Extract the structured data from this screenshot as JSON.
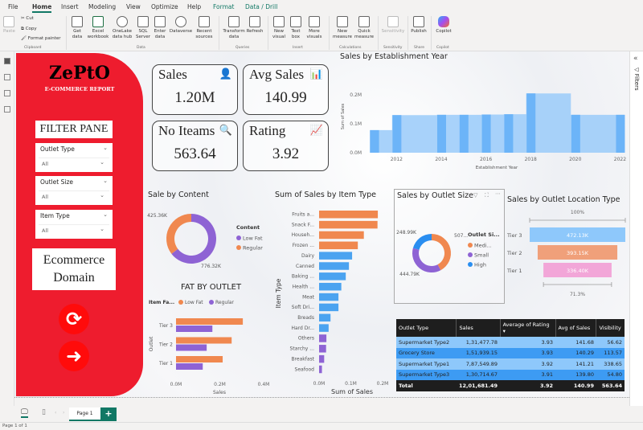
{
  "ribbon": {
    "tabs": [
      "File",
      "Home",
      "Insert",
      "Modeling",
      "View",
      "Optimize",
      "Help",
      "Format",
      "Data / Drill"
    ],
    "active_tab": "Home",
    "buttons": {
      "paste": "Paste",
      "cut": "Cut",
      "copy": "Copy",
      "format_painter": "Format painter",
      "get_data": "Get data",
      "excel": "Excel workbook",
      "onelake": "OneLake data hub",
      "sql": "SQL Server",
      "enter_data": "Enter data",
      "dataverse": "Dataverse",
      "recent": "Recent sources",
      "transform": "Transform data",
      "refresh": "Refresh",
      "new_visual": "New visual",
      "text_box": "Text box",
      "more_visuals": "More visuals",
      "new_measure": "New measure",
      "quick_measure": "Quick measure",
      "sensitivity": "Sensitivity",
      "publish": "Publish",
      "copilot": "Copilot"
    },
    "groups": [
      "Clipboard",
      "Data",
      "Queries",
      "Insert",
      "Calculations",
      "Sensitivity",
      "Share",
      "Copilot"
    ]
  },
  "left_panel": {
    "brand": "ZePtO",
    "subtitle": "E-COMMERCE REPORT",
    "filter_title": "FILTER PANE",
    "slicers": [
      {
        "label": "Outlet Type",
        "value": "All"
      },
      {
        "label": "Outlet Size",
        "value": "All"
      },
      {
        "label": "Item Type",
        "value": "All"
      }
    ],
    "domain_box": "Ecommerce Domain",
    "color": "#ee1c2e"
  },
  "cards": [
    {
      "title": "Sales",
      "value": "1.20M",
      "icon": "sales-person-icon"
    },
    {
      "title": "Avg Sales",
      "value": "140.99",
      "icon": "bar-chart-icon"
    },
    {
      "title": "No Iteams",
      "value": "563.64",
      "icon": "search-icon"
    },
    {
      "title": "Rating",
      "value": "3.92",
      "icon": "rating-chart-icon"
    }
  ],
  "filters_pane": {
    "label": "Filters"
  },
  "chart_data": [
    {
      "type": "area",
      "title": "Sales by Establishment Year",
      "xlabel": "Establishment Year",
      "ylabel": "Sum of Sales",
      "x": [
        2011,
        2012,
        2014,
        2015,
        2016,
        2017,
        2018,
        2020,
        2022
      ],
      "values": [
        0.078,
        0.13,
        0.131,
        0.131,
        0.132,
        0.133,
        0.205,
        0.131,
        0.131
      ],
      "x_ticks": [
        "2012",
        "2014",
        "2016",
        "2018",
        "2020",
        "2022"
      ],
      "y_ticks": [
        "0.0M",
        "0.1M",
        "0.2M"
      ],
      "ylim": [
        0,
        0.25
      ],
      "color": "#6cb4f8"
    },
    {
      "type": "pie",
      "title": "Sale by Content",
      "legend_title": "Content",
      "categories": [
        "Low Fat",
        "Regular"
      ],
      "values": [
        776.32,
        425.36
      ],
      "labels": [
        "776.32K",
        "425.36K"
      ],
      "colors": [
        "#8e63d4",
        "#f0884f"
      ]
    },
    {
      "type": "bar",
      "title": "FAT BY OUTLET",
      "legend_title": "Item Fa...",
      "xlabel": "Sales",
      "ylabel": "Outlet",
      "categories": [
        "Tier 3",
        "Tier 2",
        "Tier 1"
      ],
      "series": [
        {
          "name": "Low Fat",
          "values": [
            0.305,
            0.254,
            0.213
          ],
          "color": "#f0884f"
        },
        {
          "name": "Regular",
          "values": [
            0.166,
            0.14,
            0.122
          ],
          "color": "#8e63d4"
        }
      ],
      "x_ticks": [
        "0.0M",
        "0.2M",
        "0.4M"
      ],
      "xlim": [
        0,
        0.4
      ]
    },
    {
      "type": "bar",
      "title": "Sum of Sales by Item Type",
      "xlabel": "Sum of Sales",
      "ylabel": "Item Type",
      "categories": [
        "Fruits a...",
        "Snack F...",
        "Househ...",
        "Frozen ...",
        "Dairy",
        "Canned",
        "Baking ...",
        "Health ...",
        "Meat",
        "Soft Dri...",
        "Breads",
        "Hard Dr...",
        "Others",
        "Starchy ...",
        "Breakfast",
        "Seafood"
      ],
      "values": [
        0.185,
        0.184,
        0.141,
        0.122,
        0.104,
        0.094,
        0.084,
        0.07,
        0.061,
        0.061,
        0.036,
        0.03,
        0.023,
        0.022,
        0.016,
        0.009
      ],
      "colors": [
        "#f0884f",
        "#f0884f",
        "#f0884f",
        "#f0884f",
        "#4ba3f0",
        "#4ba3f0",
        "#4ba3f0",
        "#4ba3f0",
        "#4ba3f0",
        "#4ba3f0",
        "#4ba3f0",
        "#4ba3f0",
        "#8e63d4",
        "#8e63d4",
        "#8e63d4",
        "#8e63d4"
      ],
      "x_ticks": [
        "0.0M",
        "0.1M",
        "0.2M"
      ],
      "xlim": [
        0,
        0.2
      ]
    },
    {
      "type": "pie",
      "title": "Sales by Outlet Size",
      "legend_title": "Outlet Si...",
      "categories": [
        "Medi...",
        "Small",
        "High"
      ],
      "values": [
        507,
        444.79,
        248.99
      ],
      "labels": [
        "507...",
        "444.79K",
        "248.99K"
      ],
      "colors": [
        "#f0884f",
        "#8e63d4",
        "#2a8ef0"
      ]
    },
    {
      "type": "funnel",
      "title": "Sales by Outlet Location Type",
      "categories": [
        "Tier 3",
        "Tier 2",
        "Tier 1"
      ],
      "values": [
        472.13,
        393.15,
        336.4
      ],
      "labels": [
        "472.13K",
        "393.15K",
        "336.40K"
      ],
      "top_label": "100%",
      "bottom_label": "71.3%",
      "colors": [
        "#8ec8fb",
        "#f0a07a",
        "#f2a6d8"
      ]
    }
  ],
  "table": {
    "columns": [
      "Outlet Type",
      "Sales",
      "Average of Rating",
      "Avg of Sales",
      "Visibility"
    ],
    "rows": [
      [
        "Supermarket Type2",
        "1,31,477.78",
        "3.93",
        "141.68",
        "56.62"
      ],
      [
        "Grocery Store",
        "1,51,939.15",
        "3.93",
        "140.29",
        "113.57"
      ],
      [
        "Supermarket Type1",
        "7,87,549.89",
        "3.92",
        "141.21",
        "338.65"
      ],
      [
        "Supermarket Type3",
        "1,30,714.67",
        "3.91",
        "139.80",
        "54.80"
      ]
    ],
    "total": [
      "Total",
      "12,01,681.49",
      "3.92",
      "140.99",
      "563.64"
    ]
  },
  "pages": {
    "tabs": [
      "Page 1"
    ],
    "status": "Page 1 of 1"
  }
}
